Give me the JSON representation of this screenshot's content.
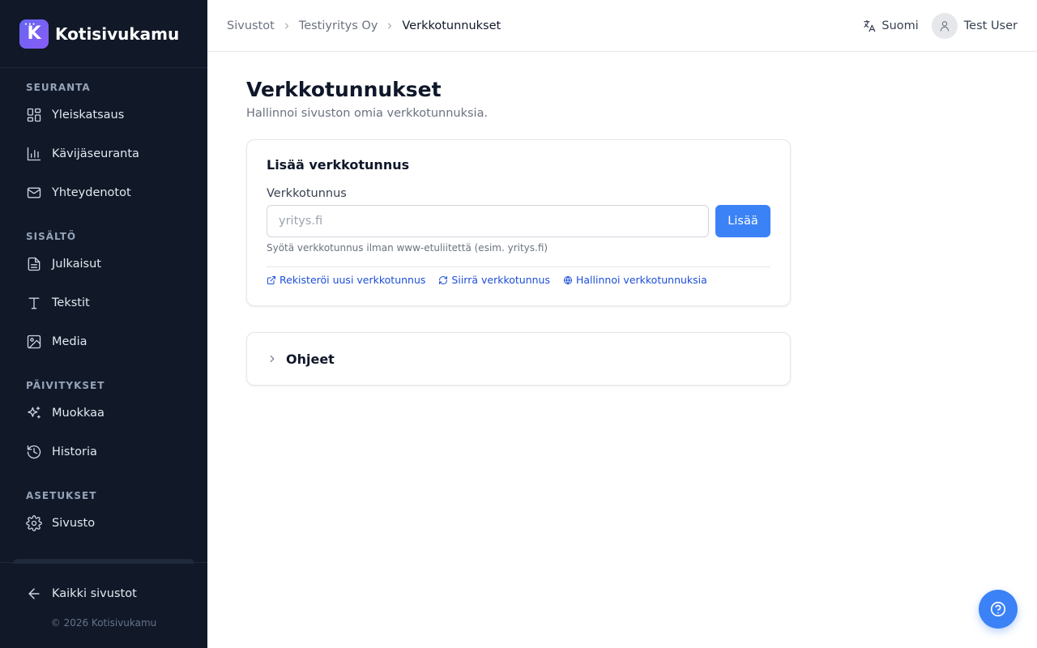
{
  "brand": {
    "name": "Kotisivukamu",
    "logo_letter": "K",
    "logo_dots": "•••"
  },
  "sidebar": {
    "sections": [
      {
        "title": "SEURANTA",
        "items": [
          {
            "label": "Yleiskatsaus",
            "icon": "layout-grid-icon"
          },
          {
            "label": "Kävijäseuranta",
            "icon": "bar-chart-icon"
          },
          {
            "label": "Yhteydenotot",
            "icon": "mail-icon"
          }
        ]
      },
      {
        "title": "SISÄLTÖ",
        "items": [
          {
            "label": "Julkaisut",
            "icon": "file-text-icon"
          },
          {
            "label": "Tekstit",
            "icon": "type-icon"
          },
          {
            "label": "Media",
            "icon": "image-icon"
          }
        ]
      },
      {
        "title": "PÄIVITYKSET",
        "items": [
          {
            "label": "Muokkaa",
            "icon": "sparkles-icon"
          },
          {
            "label": "Historia",
            "icon": "history-icon"
          }
        ]
      },
      {
        "title": "ASETUKSET",
        "items": [
          {
            "label": "Sivusto",
            "icon": "gear-icon"
          }
        ]
      }
    ],
    "back_label": "Kaikki sivustot",
    "copyright": "© 2026 Kotisivukamu"
  },
  "header": {
    "breadcrumbs": [
      "Sivustot",
      "Testiyritys Oy",
      "Verkkotunnukset"
    ],
    "language": "Suomi",
    "user_name": "Test User"
  },
  "main": {
    "title": "Verkkotunnukset",
    "subtitle": "Hallinnoi sivuston omia verkkotunnuksia.",
    "add_card": {
      "title": "Lisää verkkotunnus",
      "field_label": "Verkkotunnus",
      "input_value": "",
      "input_placeholder": "yritys.fi",
      "button_label": "Lisää",
      "hint": "Syötä verkkotunnus ilman www-etuliitettä (esim. yritys.fi)",
      "links": [
        {
          "label": "Rekisteröi uusi verkkotunnus",
          "icon": "external-link-icon"
        },
        {
          "label": "Siirrä verkkotunnus",
          "icon": "refresh-icon"
        },
        {
          "label": "Hallinnoi verkkotunnuksia",
          "icon": "globe-icon"
        }
      ]
    },
    "help_card": {
      "title": "Ohjeet",
      "expanded": false
    }
  },
  "colors": {
    "sidebar_bg": "#111827",
    "accent": "#3b82f6",
    "link": "#1d4ed8"
  }
}
